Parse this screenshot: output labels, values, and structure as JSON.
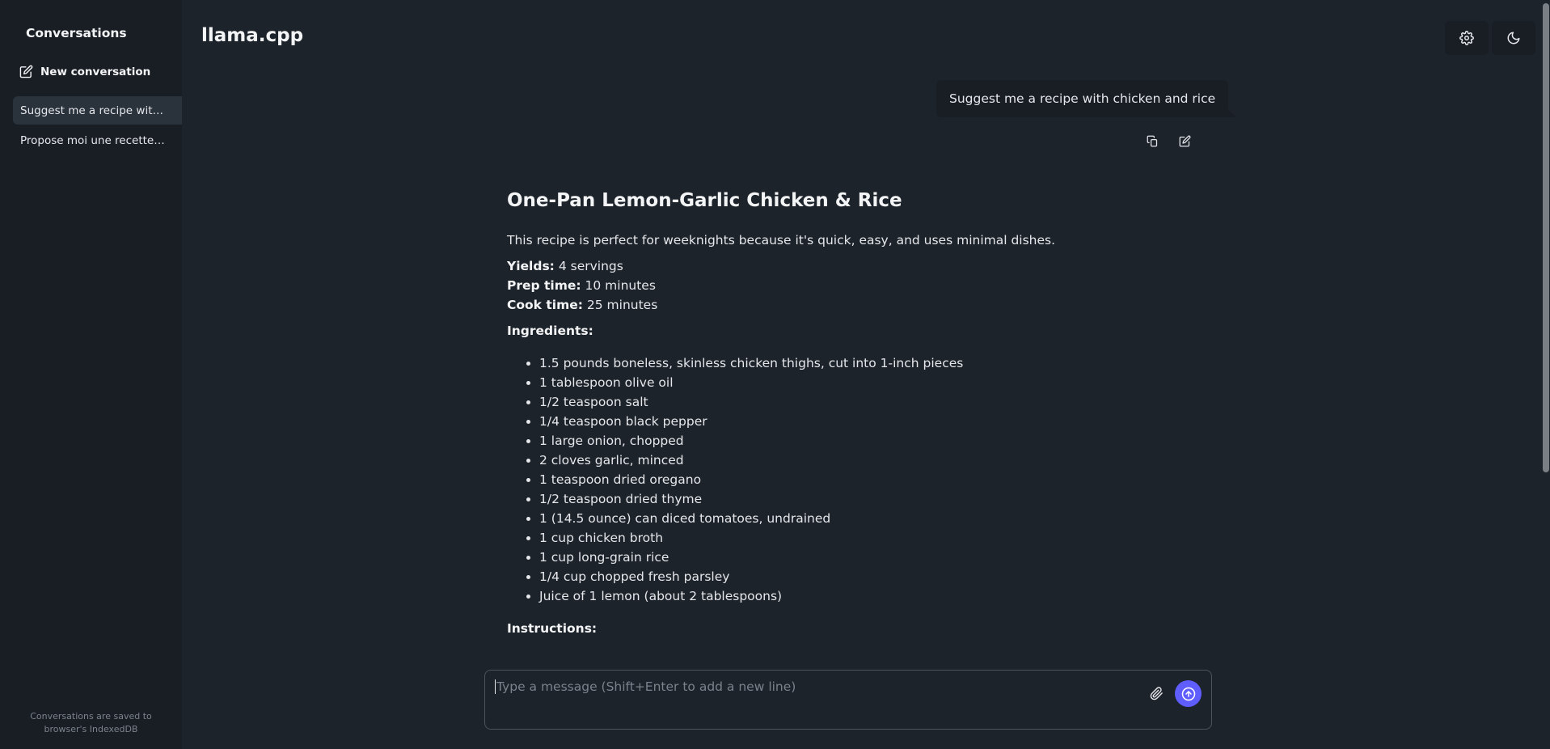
{
  "sidebar": {
    "title": "Conversations",
    "new_conversation": "New conversation",
    "conversations": [
      "Suggest me a recipe with chicken and rice",
      "Propose moi une recette avec du poulet et du riz"
    ],
    "footer_line1": "Conversations are saved to",
    "footer_line2": "browser's IndexedDB"
  },
  "header": {
    "title": "llama.cpp",
    "settings_icon": "gear-icon",
    "theme_icon": "moon-icon"
  },
  "chat": {
    "user_message": "Suggest me a recipe with chicken and rice",
    "assistant": {
      "heading": "One-Pan Lemon-Garlic Chicken & Rice",
      "intro": "This recipe is perfect for weeknights because it's quick, easy, and uses minimal dishes.",
      "yields_label": "Yields:",
      "yields_value": "4 servings",
      "prep_label": "Prep time:",
      "prep_value": "10 minutes",
      "cook_label": "Cook time:",
      "cook_value": "25 minutes",
      "ingredients_label": "Ingredients:",
      "ingredients": [
        "1.5 pounds boneless, skinless chicken thighs, cut into 1-inch pieces",
        "1 tablespoon olive oil",
        "1/2 teaspoon salt",
        "1/4 teaspoon black pepper",
        "1 large onion, chopped",
        "2 cloves garlic, minced",
        "1 teaspoon dried oregano",
        "1/2 teaspoon dried thyme",
        "1 (14.5 ounce) can diced tomatoes, undrained",
        "1 cup chicken broth",
        "1 cup long-grain rice",
        "1/4 cup chopped fresh parsley",
        "Juice of 1 lemon (about 2 tablespoons)"
      ],
      "instructions_label": "Instructions:"
    }
  },
  "composer": {
    "placeholder": "Type a message (Shift+Enter to add a new line)",
    "value": "",
    "send_color": "#605dff"
  }
}
